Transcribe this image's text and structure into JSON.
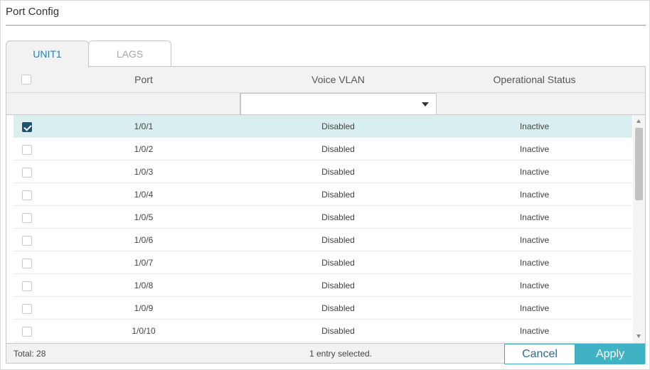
{
  "page": {
    "title": "Port Config"
  },
  "tabs": [
    {
      "label": "UNIT1",
      "active": true
    },
    {
      "label": "LAGS",
      "active": false
    }
  ],
  "table": {
    "columns": {
      "port": "Port",
      "voice_vlan": "Voice VLAN",
      "status": "Operational Status"
    },
    "filter": {
      "voice_vlan_value": ""
    },
    "rows": [
      {
        "port": "1/0/1",
        "voice_vlan": "Disabled",
        "status": "Inactive",
        "checked": true
      },
      {
        "port": "1/0/2",
        "voice_vlan": "Disabled",
        "status": "Inactive",
        "checked": false
      },
      {
        "port": "1/0/3",
        "voice_vlan": "Disabled",
        "status": "Inactive",
        "checked": false
      },
      {
        "port": "1/0/4",
        "voice_vlan": "Disabled",
        "status": "Inactive",
        "checked": false
      },
      {
        "port": "1/0/5",
        "voice_vlan": "Disabled",
        "status": "Inactive",
        "checked": false
      },
      {
        "port": "1/0/6",
        "voice_vlan": "Disabled",
        "status": "Inactive",
        "checked": false
      },
      {
        "port": "1/0/7",
        "voice_vlan": "Disabled",
        "status": "Inactive",
        "checked": false
      },
      {
        "port": "1/0/8",
        "voice_vlan": "Disabled",
        "status": "Inactive",
        "checked": false
      },
      {
        "port": "1/0/9",
        "voice_vlan": "Disabled",
        "status": "Inactive",
        "checked": false
      },
      {
        "port": "1/0/10",
        "voice_vlan": "Disabled",
        "status": "Inactive",
        "checked": false
      }
    ]
  },
  "footer": {
    "total": "Total: 28",
    "selected_info": "1 entry selected.",
    "cancel_label": "Cancel",
    "apply_label": "Apply"
  },
  "colors": {
    "accent": "#3fb2c3",
    "selected_row": "#d9eeee",
    "checkbox_checked": "#1f5070",
    "tab_active_text": "#2a7fa5"
  }
}
